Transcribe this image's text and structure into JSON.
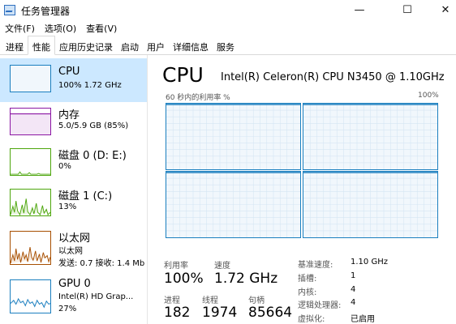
{
  "window": {
    "title": "任务管理器",
    "controls": {
      "minimize": "—",
      "maximize": "☐",
      "close": "✕"
    }
  },
  "menu": [
    "文件(F)",
    "选项(O)",
    "查看(V)"
  ],
  "tabs": [
    "进程",
    "性能",
    "应用历史记录",
    "启动",
    "用户",
    "详细信息",
    "服务"
  ],
  "active_tab": "性能",
  "sidebar": {
    "items": [
      {
        "name": "CPU",
        "sub": "100% 1.72 GHz",
        "color": "#1a7fbf",
        "selected": true
      },
      {
        "name": "内存",
        "sub": "5.0/5.9 GB (85%)",
        "color": "#8b16a3"
      },
      {
        "name": "磁盘 0 (D: E:)",
        "sub": "0%",
        "color": "#4da60c"
      },
      {
        "name": "磁盘 1 (C:)",
        "sub": "13%",
        "color": "#4da60c"
      },
      {
        "name": "以太网",
        "sub2": "以太网",
        "sub": "发送: 0.7  接收: 1.4 Mb",
        "color": "#a74f01"
      },
      {
        "name": "GPU 0",
        "sub2": "Intel(R) HD Grap...",
        "sub": "27%",
        "color": "#1a7fbf"
      }
    ]
  },
  "main": {
    "title": "CPU",
    "model": "Intel(R) Celeron(R) CPU N3450 @ 1.10GHz",
    "graph_label": "60 秒内的利用率 %",
    "graph_max": "100%",
    "stats": {
      "util_label": "利用率",
      "util_value": "100%",
      "speed_label": "速度",
      "speed_value": "1.72 GHz",
      "proc_label": "进程",
      "proc_value": "182",
      "thread_label": "线程",
      "thread_value": "1974",
      "handle_label": "句柄",
      "handle_value": "85664"
    },
    "details": [
      {
        "label": "基准速度:",
        "value": "1.10 GHz"
      },
      {
        "label": "插槽:",
        "value": "1"
      },
      {
        "label": "内核:",
        "value": "4"
      },
      {
        "label": "逻辑处理器:",
        "value": "4"
      },
      {
        "label": "虚拟化:",
        "value": "已启用"
      }
    ]
  }
}
